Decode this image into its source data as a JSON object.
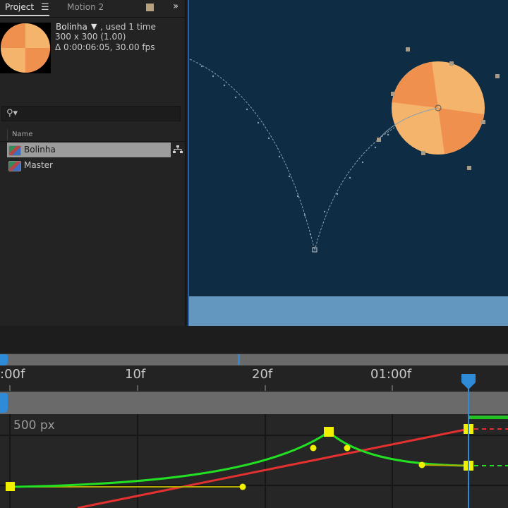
{
  "project_panel": {
    "tabs": [
      {
        "label": "Project",
        "active": true
      },
      {
        "label": "Motion 2",
        "active": false
      }
    ],
    "menu_icon": "hamburger-menu-icon",
    "overflow_icon": "double-chevron-icon",
    "tab_color": "#b7a17d",
    "selected_item_info": {
      "name": "Bolinha",
      "usage": ", used 1 time",
      "dimensions": "300 x 300 (1.00)",
      "duration": "Δ 0:00:06:05, 30.00 fps"
    },
    "search": {
      "icon": "search-icon",
      "placeholder": ""
    },
    "column_header": "Name",
    "items": [
      {
        "label": "Bolinha",
        "selected": true,
        "icon": "composition-icon"
      },
      {
        "label": "Master",
        "selected": false,
        "icon": "composition-icon"
      }
    ],
    "flowchart_icon": "flowchart-icon"
  },
  "viewer": {
    "background": "#0e2c44",
    "floor_color": "#6397c0",
    "ball_colors": [
      "#f5b46c",
      "#f0904e"
    ]
  },
  "timeline": {
    "ruler_labels": [
      ":00f",
      "10f",
      "20f",
      "01:00f"
    ],
    "graph_scale_label": "500 px",
    "playhead_color": "#2f8ad8",
    "curve_colors": {
      "speed": "#22e022",
      "value": "#e53030",
      "handle": "#f0f000"
    }
  }
}
